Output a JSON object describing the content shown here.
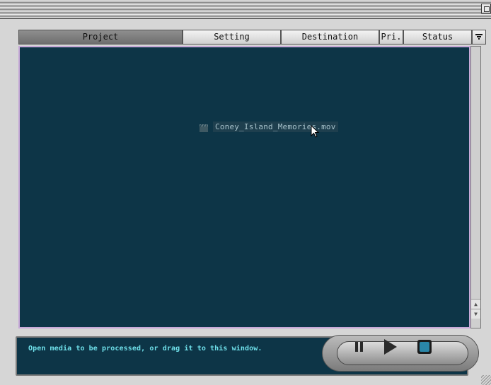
{
  "columns": [
    {
      "label": "Project",
      "selected": true
    },
    {
      "label": "Setting"
    },
    {
      "label": "Destination"
    },
    {
      "label": "Pri."
    },
    {
      "label": "Status"
    }
  ],
  "sort_icon": "sort-lines-icon",
  "dragged_item": {
    "filename": "Coney_Island_Memories.mov",
    "icon": "movie-file-icon"
  },
  "status_message": "Open media to be processed, or drag it to this window.",
  "transport": {
    "pause_icon": "pause-icon",
    "play_icon": "play-icon",
    "stop_icon": "stop-icon"
  },
  "colors": {
    "list_bg": "#0d3547",
    "status_text": "#6fe0ea",
    "list_border": "#c7a9d8",
    "stop_blue": "#2a86a8"
  }
}
